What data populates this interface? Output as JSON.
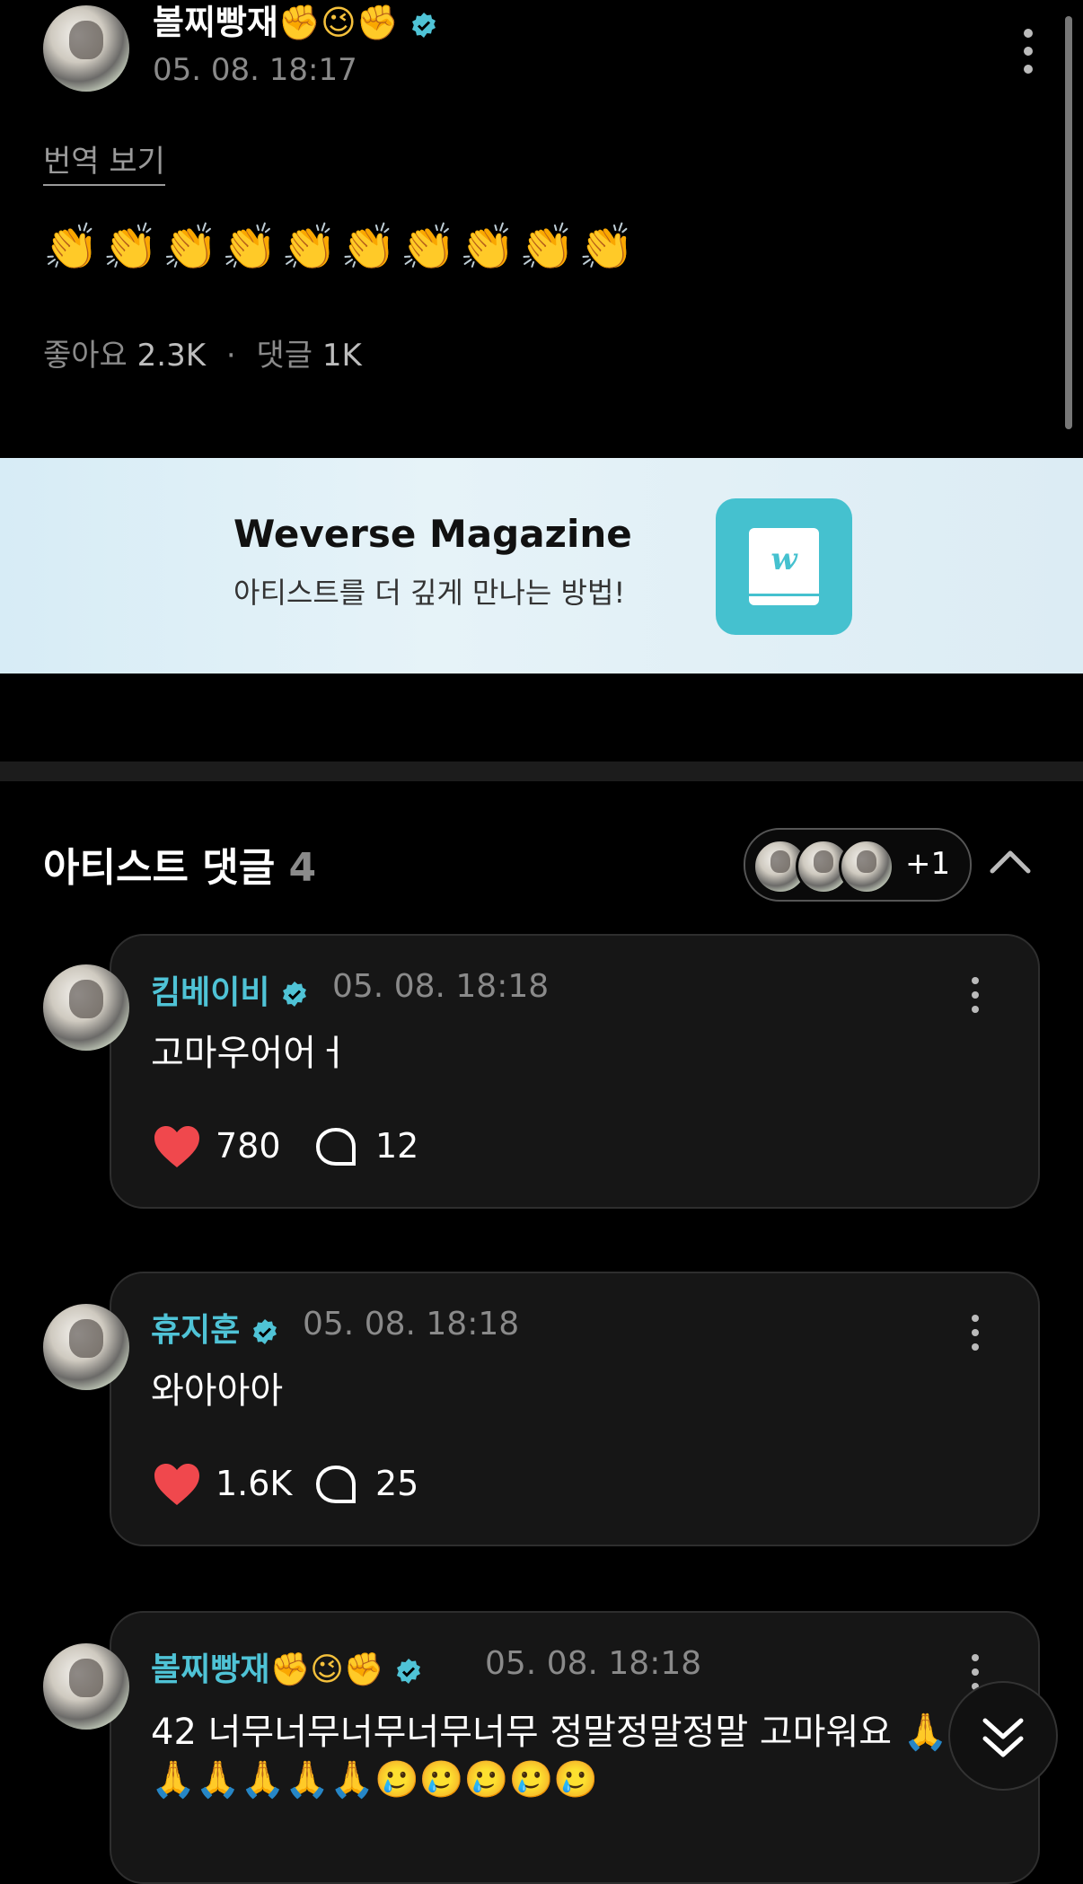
{
  "post": {
    "author": "볼찌빵재",
    "author_emojis": "✊😉✊",
    "date": "05. 08. 18:17",
    "translate_label": "번역 보기",
    "content": "👏👏👏👏👏👏👏👏👏👏",
    "likes_label": "좋아요",
    "likes_count": "2.3K",
    "separator": "·",
    "comments_label": "댓글",
    "comments_count": "1K"
  },
  "banner": {
    "title": "Weverse Magazine",
    "subtitle": "아티스트를 더 깊게 만나는 방법!",
    "icon": "weverse-book-icon",
    "icon_letter": "w"
  },
  "artist_comments": {
    "title": "아티스트 댓글",
    "count": "4",
    "more_avatars": "+1"
  },
  "comments": [
    {
      "author": "킴베이비",
      "date": "05. 08. 18:18",
      "text": "고마우어어ㅓ",
      "likes": "780",
      "replies": "12"
    },
    {
      "author": "휴지훈",
      "date": "05. 08. 18:18",
      "text": "와아아아",
      "likes": "1.6K",
      "replies": "25"
    },
    {
      "author": "볼찌빵재",
      "author_emojis": "✊😉✊",
      "date": "05. 08. 18:18",
      "text": "42 너무너무너무너무너무 정말정말정말 고마워요 🙏",
      "text2": "🙏🙏🙏🙏🙏🥲🥲🥲🥲🥲"
    }
  ],
  "colors": {
    "accent": "#4fc3d6",
    "heart": "#f0484d",
    "banner_icon": "#45c1cf"
  }
}
